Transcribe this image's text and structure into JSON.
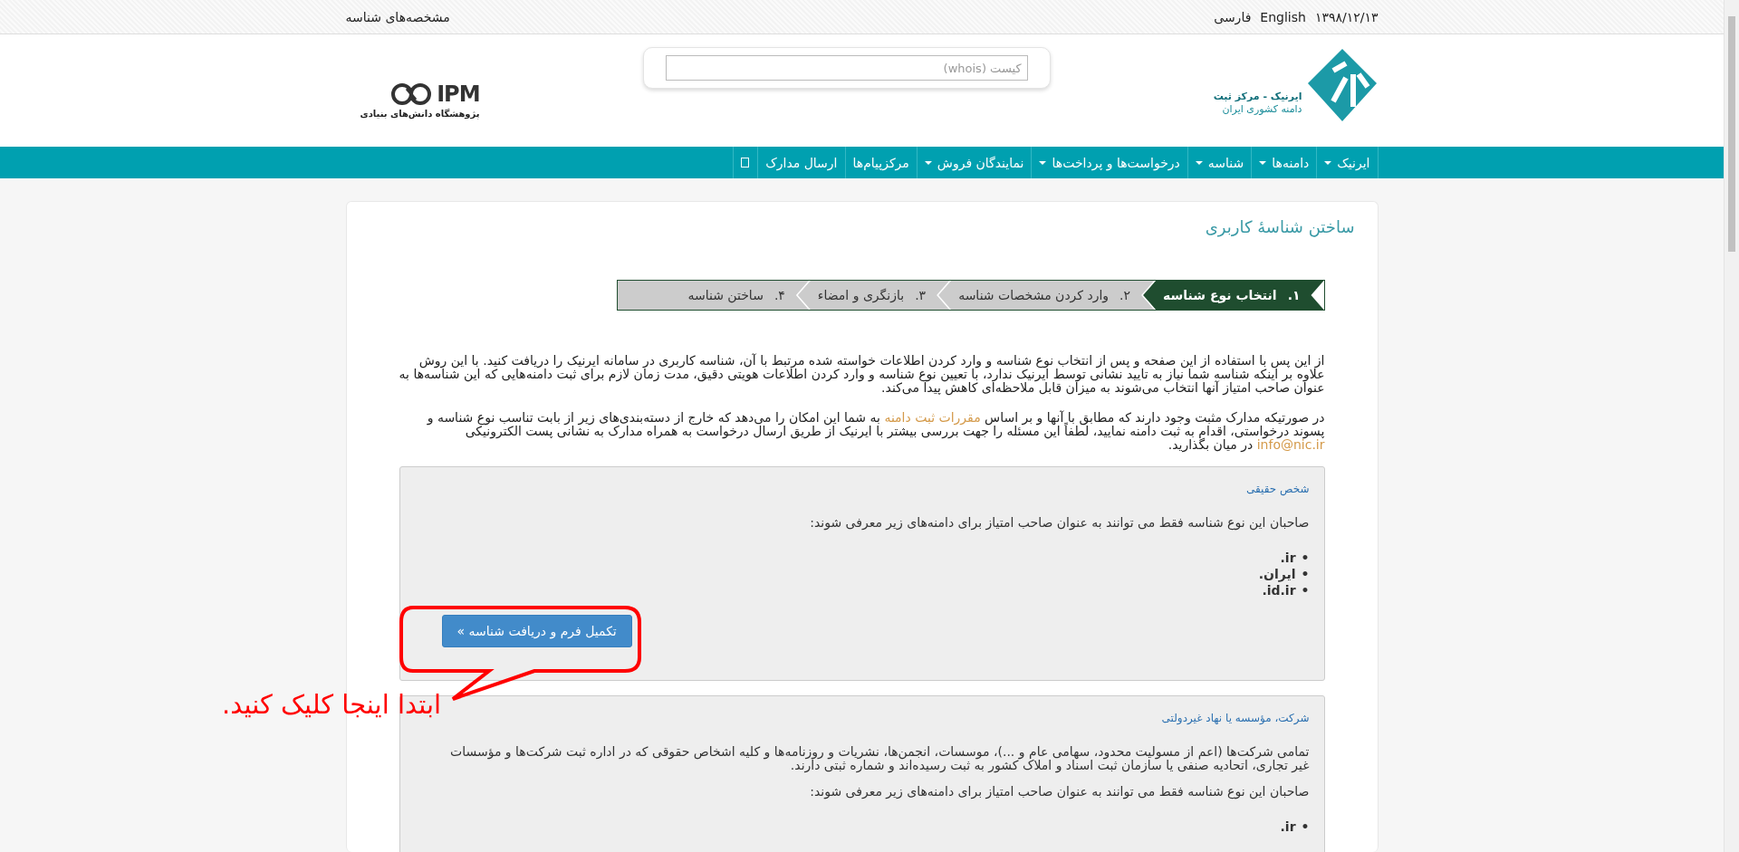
{
  "top_bar": {
    "items": [
      "۱۳۹۸/۱۲/۱۳",
      "English",
      "فارسی"
    ],
    "title": "مشخصه‌های شناسه"
  },
  "header": {
    "brand_lines": [
      "ایرنیک - مرکز ثبت",
      "دامنه کشوری ایران"
    ],
    "search": {
      "placeholder": "کیست (whois)"
    },
    "partner": {
      "name": "IPM",
      "subtitle": "پژوهشگاه دانش‌های بنیادی"
    }
  },
  "nav": [
    {
      "label": "ایرنیک",
      "dropdown": true
    },
    {
      "label": "دامنه‌ها",
      "dropdown": true
    },
    {
      "label": "شناسه",
      "dropdown": true
    },
    {
      "label": "درخواست‌ها و پرداخت‌ها",
      "dropdown": true
    },
    {
      "label": "نمایندگان فروش",
      "dropdown": true
    },
    {
      "label": "مرکزپیام‌ها",
      "dropdown": false
    },
    {
      "label": "ارسال مدارک",
      "dropdown": false
    },
    {
      "kind": "icon",
      "dropdown": false
    }
  ],
  "page_title": "ساختن شناسهٔ کاربری",
  "steps": [
    {
      "number": "۱.",
      "label": "انتخاب نوع شناسه",
      "selected": true
    },
    {
      "number": "۲.",
      "label": "وارد کردن مشخصات شناسه",
      "selected": false
    },
    {
      "number": "۳.",
      "label": "بازنگری و امضاء",
      "selected": false
    },
    {
      "number": "۴.",
      "label": "ساختن شناسه",
      "selected": false
    }
  ],
  "paragraphs": [
    [
      {
        "kind": "text",
        "text": "از این پس با استفاده از این صفحه و پس از انتخاب نوع شناسه و وارد کردن اطلاعات خواسته شده مرتبط با آن، شناسه کاربری در سامانه ایرنیک را دریافت کنید. با این روش علاوه بر اینکه شناسه شما نیاز به تایید نشانی توسط ایرنیک ندارد، با تعیین نوع شناسه و وارد کردن اطلاعات هویتی دقیق، مدت زمان لازم برای ثبت دامنه‌هایی که این شناسه‌ها به عنوان صاحب امتیاز آنها انتخاب می‌شوند به میزان قابل ملاحظه‌ای کاهش پیدا می‌کند."
      }
    ],
    [
      {
        "kind": "text",
        "text": "در صورتیکه مدارک مثبت وجود دارند که مطابق با آنها و بر اساس "
      },
      {
        "kind": "link",
        "text": "مقررات ثبت دامنه"
      },
      {
        "kind": "text",
        "text": " به شما این امکان را می‌دهد که خارج از دسته‌بندی‌های زیر از بابت تناسب نوع شناسه و پسوند درخواستی، اقدام به ثبت دامنه نمایید، لطفاً این مسئله را جهت بررسی بیشتر با ایرنیک از طریق ارسال درخواست به همراه مدارک به نشانی پست الکترونیکی "
      },
      {
        "kind": "link",
        "text": "info@nic.ir"
      },
      {
        "kind": "text",
        "text": " در میان بگذارید."
      }
    ]
  ],
  "boxes": [
    {
      "title": "شخص حقیقی",
      "texts": [
        "صاحبان این نوع شناسه فقط می توانند به عنوان صاحب امتیاز برای دامنه‌های زیر معرفی شوند:"
      ],
      "bullet": "•",
      "domains": [
        ".ir",
        ".ایران",
        ".id.ir"
      ],
      "button": "تکمیل فرم و دریافت شناسه »"
    },
    {
      "title": "شرکت، مؤسسه یا نهاد غیردولتی",
      "texts": [
        "تمامی شرکت‌ها (اعم از مسولیت محدود، سهامی عام و ...)، موسسات، انجمن‌ها، نشریات و روزنامه‌ها و کلیه اشخاص حقوقی که در اداره ثبت شرکت‌ها و مؤسسات غیر تجاری، اتحادیه صنفی یا سازمان ثبت اسناد و املاک کشور به ثبت رسیده‌اند و شماره ثبتی دارند.",
        "صاحبان این نوع شناسه فقط می توانند به عنوان صاحب امتیاز برای دامنه‌های زیر معرفی شوند:"
      ],
      "bullet": "•",
      "domains": [
        ".ir"
      ]
    }
  ],
  "annotation": {
    "text": "ابتدا اینجا کلیک کنید."
  }
}
